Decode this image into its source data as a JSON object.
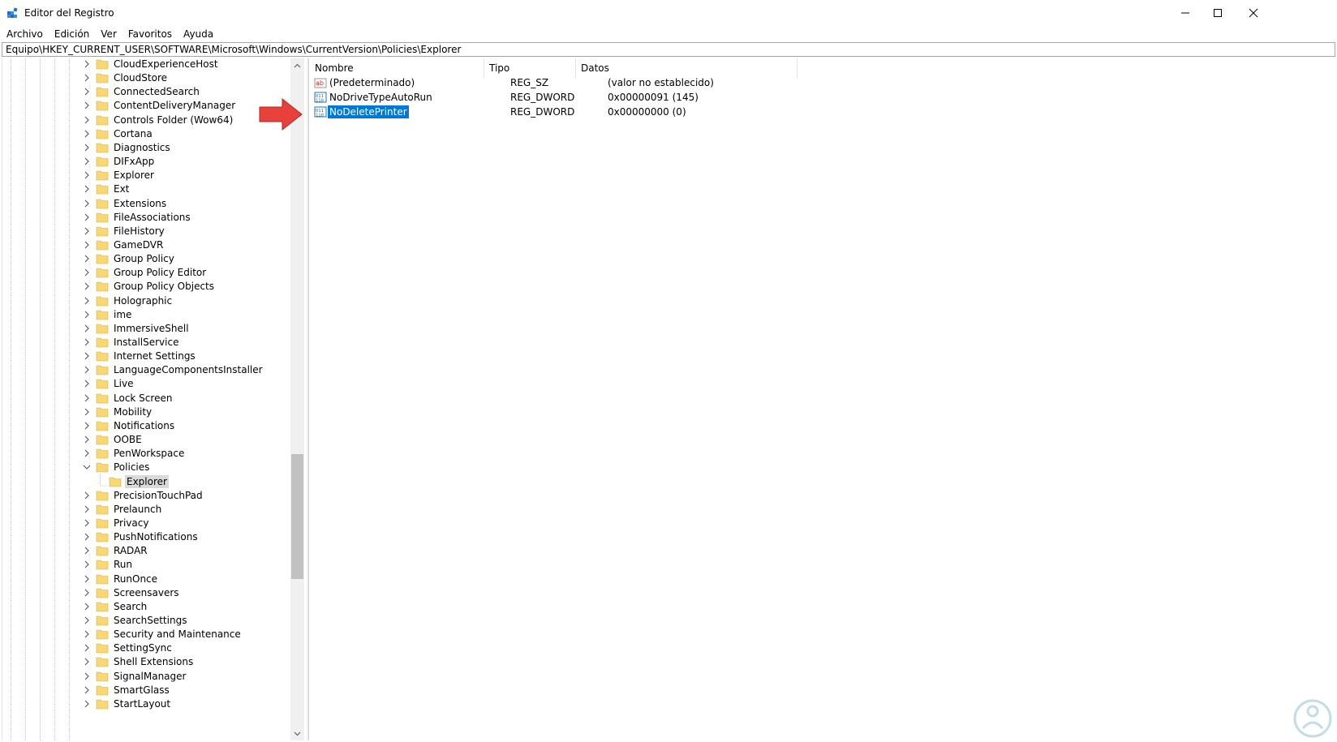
{
  "window": {
    "title": "Editor del Registro",
    "app_icon": "registry-editor-icon"
  },
  "menu": [
    "Archivo",
    "Edición",
    "Ver",
    "Favoritos",
    "Ayuda"
  ],
  "address": "Equipo\\HKEY_CURRENT_USER\\SOFTWARE\\Microsoft\\Windows\\CurrentVersion\\Policies\\Explorer",
  "tree": {
    "items": [
      "CloudExperienceHost",
      "CloudStore",
      "ConnectedSearch",
      "ContentDeliveryManager",
      "Controls Folder (Wow64)",
      "Cortana",
      "Diagnostics",
      "DIFxApp",
      "Explorer",
      "Ext",
      "Extensions",
      "FileAssociations",
      "FileHistory",
      "GameDVR",
      "Group Policy",
      "Group Policy Editor",
      "Group Policy Objects",
      "Holographic",
      "ime",
      "ImmersiveShell",
      "InstallService",
      "Internet Settings",
      "LanguageComponentsInstaller",
      "Live",
      "Lock Screen",
      "Mobility",
      "Notifications",
      "OOBE",
      "PenWorkspace",
      "Policies",
      "Explorer",
      "PrecisionTouchPad",
      "Prelaunch",
      "Privacy",
      "PushNotifications",
      "RADAR",
      "Run",
      "RunOnce",
      "Screensavers",
      "Search",
      "SearchSettings",
      "Security and Maintenance",
      "SettingSync",
      "Shell Extensions",
      "SignalManager",
      "SmartGlass",
      "StartLayout"
    ],
    "expanded_item": "Policies",
    "selected_child": "Explorer"
  },
  "list": {
    "columns": [
      "Nombre",
      "Tipo",
      "Datos"
    ],
    "rows": [
      {
        "name": "(Predeterminado)",
        "type": "REG_SZ",
        "data": "(valor no establecido)",
        "icon": "string-value-icon"
      },
      {
        "name": "NoDriveTypeAutoRun",
        "type": "REG_DWORD",
        "data": "0x00000091 (145)",
        "icon": "dword-value-icon"
      },
      {
        "name": "NoDeletePrinter",
        "type": "REG_DWORD",
        "data": "0x00000000 (0)",
        "icon": "dword-value-icon",
        "selected": true
      }
    ]
  },
  "annotation": {
    "pointer": "red-arrow-icon",
    "color": "#e8403a"
  },
  "colors": {
    "selection": "#0078d7",
    "folder": "#f8d775",
    "accent": "#2a8fd0"
  }
}
